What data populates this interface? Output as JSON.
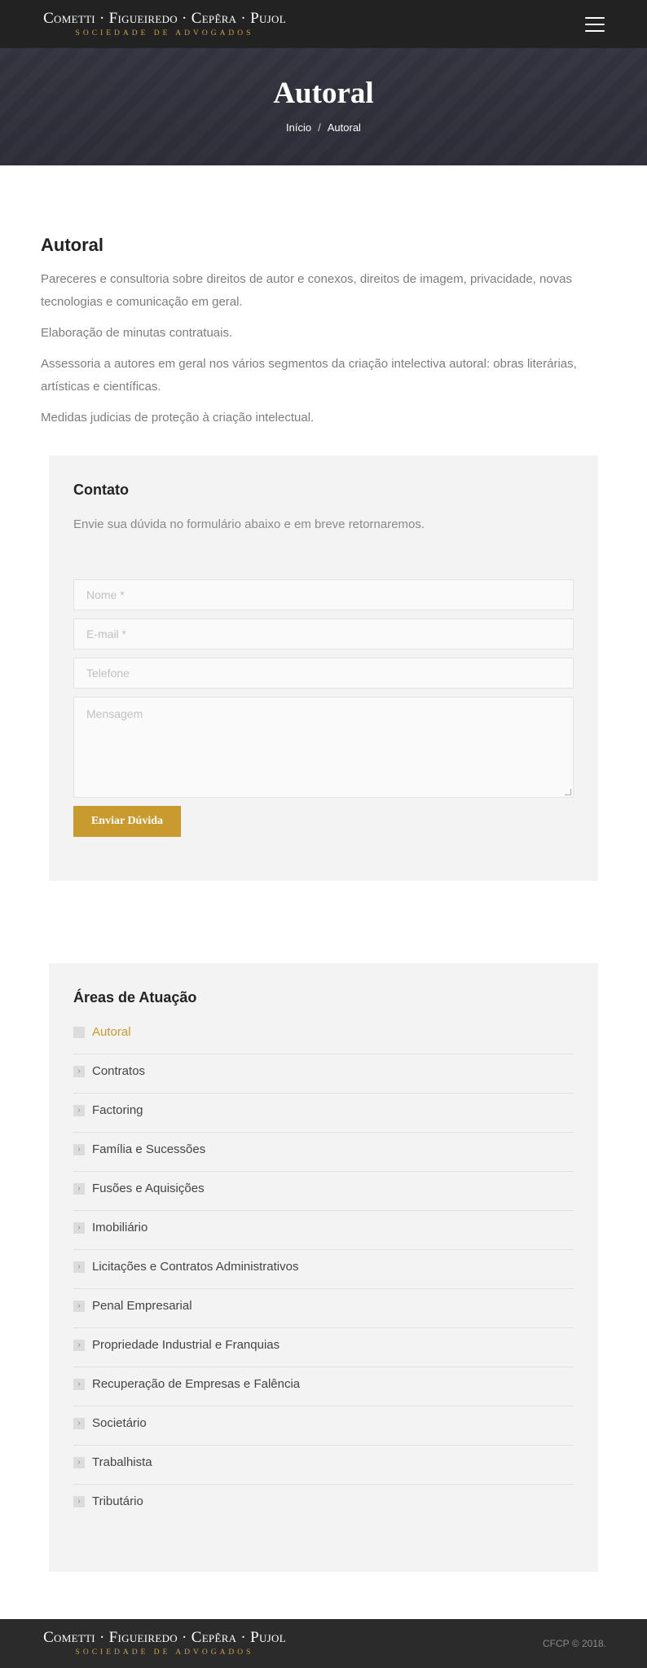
{
  "header": {
    "logo_names": "Cometti · Figueiredo · Cepêra · Pujol",
    "logo_sub": "SOCIEDADE DE ADVOGADOS",
    "menu_icon": "hamburger-icon"
  },
  "banner": {
    "title": "Autoral",
    "breadcrumb": {
      "home": "Início",
      "separator": "/",
      "current": "Autoral"
    }
  },
  "main": {
    "heading": "Autoral",
    "paragraphs": [
      "Pareceres e consultoria sobre direitos de autor e conexos, direitos de imagem, privacidade, novas tecnologias e comunicação em geral.",
      "Elaboração de minutas contratuais.",
      "Assessoria a autores em geral nos vários segmentos da criação intelectiva autoral: obras literárias, artísticas e científicas.",
      "Medidas judicias de proteção à criação intelectual."
    ]
  },
  "contact": {
    "title": "Contato",
    "description": "Envie sua dúvida no formulário abaixo e em breve retornaremos.",
    "fields": {
      "name_placeholder": "Nome *",
      "email_placeholder": "E-mail *",
      "phone_placeholder": "Telefone",
      "message_placeholder": "Mensagem"
    },
    "submit_label": "Enviar Dúvida",
    "accent_color": "#c99a2e"
  },
  "areas": {
    "title": "Áreas de Atuação",
    "items": [
      {
        "label": "Autoral",
        "active": true
      },
      {
        "label": "Contratos"
      },
      {
        "label": "Factoring"
      },
      {
        "label": "Família e Sucessões"
      },
      {
        "label": "Fusões e Aquisições"
      },
      {
        "label": "Imobiliário"
      },
      {
        "label": "Licitações e Contratos Administrativos"
      },
      {
        "label": "Penal Empresarial"
      },
      {
        "label": "Propriedade Industrial e Franquias"
      },
      {
        "label": "Recuperação de Empresas e Falência"
      },
      {
        "label": "Societário"
      },
      {
        "label": "Trabalhista"
      },
      {
        "label": "Tributário"
      }
    ]
  },
  "footer": {
    "logo_names": "Cometti · Figueiredo · Cepêra · Pujol",
    "logo_sub": "SOCIEDADE DE ADVOGADOS",
    "copyright": "CFCP © 2018."
  }
}
